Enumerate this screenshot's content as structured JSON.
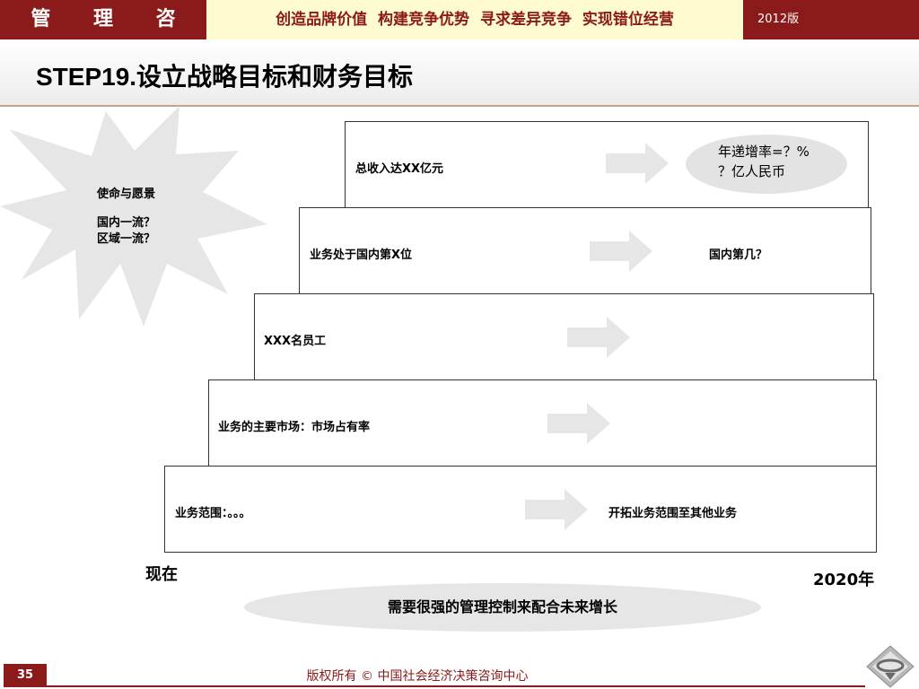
{
  "header": {
    "brand": "管 理 咨 询",
    "slogan": "创造品牌价值 构建竞争优势 寻求差异竞争 实现错位经营",
    "edition": "2012版"
  },
  "title": "STEP19.设立战略目标和财务目标",
  "mission": {
    "heading": "使命与愿景",
    "line1": "国内一流？",
    "line2": "区域一流？"
  },
  "steps": [
    {
      "label": "总收入达XX亿元",
      "target": ""
    },
    {
      "label": "业务处于国内第X位",
      "target": "国内第几？"
    },
    {
      "label": "XXX名员工",
      "target": ""
    },
    {
      "label": "业务的主要市场：市场占有率",
      "target": ""
    },
    {
      "label": "业务范围：。。。",
      "target": "开拓业务范围至其他业务"
    }
  ],
  "growth": {
    "line1": "年递增率=？%",
    "line2": "？亿人民币"
  },
  "timeline": {
    "start": "现在",
    "end": "2020年"
  },
  "summary": "需要很强的管理控制来配合未来增长",
  "footer": {
    "page_number": "35",
    "copyright": "版权所有 © 中国社会经济决策咨询中心"
  },
  "colors": {
    "brand": "#8b1a1a",
    "slogan_bg": "#fffbd0",
    "arrow": "#e6e6e6",
    "ellipse": "#e3e3e3"
  }
}
